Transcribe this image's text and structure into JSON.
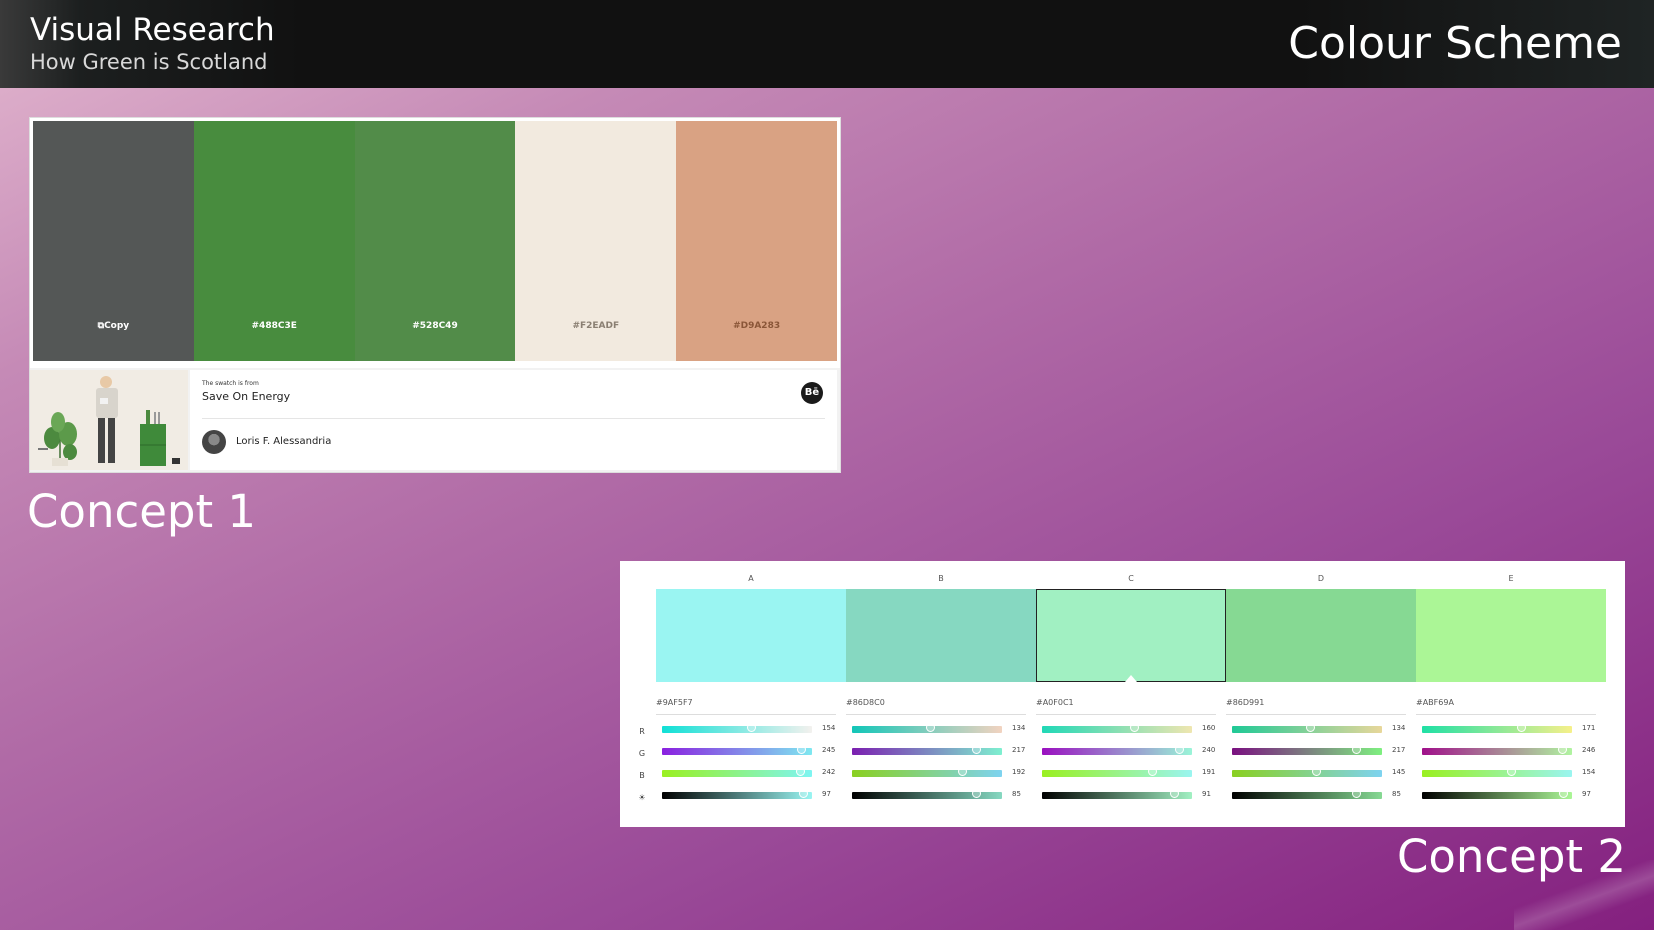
{
  "header": {
    "title": "Visual Research",
    "subtitle": "How Green is Scotland",
    "page_title": "Colour Scheme"
  },
  "concept1": {
    "label": "Concept 1",
    "swatches": [
      {
        "color": "#545756",
        "code": "Copy"
      },
      {
        "color": "#488C3E",
        "code": "#488C3E"
      },
      {
        "color": "#528C49",
        "code": "#528C49"
      },
      {
        "color": "#F2EADF",
        "code": "#F2EADF"
      },
      {
        "color": "#D9A283",
        "code": "#D9A283"
      }
    ],
    "project_small": "The swatch is from",
    "project_name": "Save On Energy",
    "author": "Loris F. Alessandria",
    "behance_icon": "Bē"
  },
  "concept2": {
    "label": "Concept 2",
    "columns": [
      "A",
      "B",
      "C",
      "D",
      "E"
    ],
    "selected_index": 2,
    "colors": [
      {
        "swatch": "#9AF5F2",
        "hex": "#9AF5F7",
        "r": 154,
        "g": 245,
        "b": 242,
        "alpha": 97
      },
      {
        "swatch": "#86D8C1",
        "hex": "#86D8C0",
        "r": 134,
        "g": 217,
        "b": 192,
        "alpha": 85
      },
      {
        "swatch": "#A1F0C2",
        "hex": "#A0F0C1",
        "r": 160,
        "g": 240,
        "b": 191,
        "alpha": 91
      },
      {
        "swatch": "#86D993",
        "hex": "#86D991",
        "r": 134,
        "g": 217,
        "b": 145,
        "alpha": 85
      },
      {
        "swatch": "#ABF696",
        "hex": "#ABF69A",
        "r": 171,
        "g": 246,
        "b": 154,
        "alpha": 97
      }
    ],
    "row_labels": [
      "R",
      "G",
      "B",
      "☀"
    ]
  }
}
